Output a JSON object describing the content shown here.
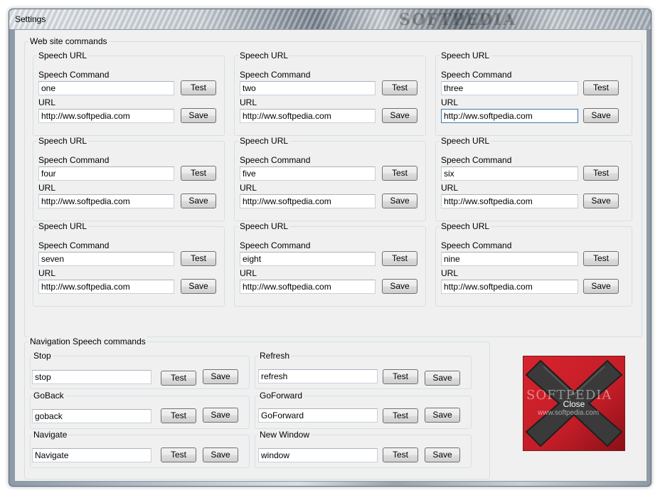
{
  "window": {
    "title": "Settings",
    "watermark": "SOFTPEDIA"
  },
  "web": {
    "label": "Web site commands",
    "boxes": [
      {
        "title": "Speech URL",
        "cmd_label": "Speech Command",
        "cmd": "one",
        "url_label": "URL",
        "url": "http://ww.softpedia.com"
      },
      {
        "title": "Speech URL",
        "cmd_label": "Speech Command",
        "cmd": "two",
        "url_label": "URL",
        "url": "http://ww.softpedia.com"
      },
      {
        "title": "Speech URL",
        "cmd_label": "Speech Command",
        "cmd": "three",
        "url_label": "URL",
        "url": "http://ww.softpedia.com"
      },
      {
        "title": "Speech URL",
        "cmd_label": "Speech Command",
        "cmd": "four",
        "url_label": "URL",
        "url": "http://ww.softpedia.com"
      },
      {
        "title": "Speech URL",
        "cmd_label": "Speech Command",
        "cmd": "five",
        "url_label": "URL",
        "url": "http://ww.softpedia.com"
      },
      {
        "title": "Speech URL",
        "cmd_label": "Speech Command",
        "cmd": "six",
        "url_label": "URL",
        "url": "http://ww.softpedia.com"
      },
      {
        "title": "Speech URL",
        "cmd_label": "Speech Command",
        "cmd": "seven",
        "url_label": "URL",
        "url": "http://ww.softpedia.com"
      },
      {
        "title": "Speech URL",
        "cmd_label": "Speech Command",
        "cmd": "eight",
        "url_label": "URL",
        "url": "http://ww.softpedia.com"
      },
      {
        "title": "Speech URL",
        "cmd_label": "Speech Command",
        "cmd": "nine",
        "url_label": "URL",
        "url": "http://ww.softpedia.com"
      }
    ]
  },
  "nav": {
    "label": "Navigation Speech commands",
    "items": [
      {
        "title": "Stop",
        "value": "stop"
      },
      {
        "title": "Refresh",
        "value": "refresh"
      },
      {
        "title": "GoBack",
        "value": "goback"
      },
      {
        "title": "GoForward",
        "value": "GoForward"
      },
      {
        "title": "Navigate",
        "value": "Navigate"
      },
      {
        "title": "New Window",
        "value": "window"
      }
    ]
  },
  "buttons": {
    "test": "Test",
    "save": "Save"
  },
  "close": {
    "label": "Close",
    "watermark": "SOFTPEDIA",
    "watermark_url": "www.softpedia.com",
    "icon": "x-icon"
  },
  "colors": {
    "close_bg": "#c9202a",
    "x_color": "#3a3a3a",
    "focus_border": "#3d7bad"
  }
}
